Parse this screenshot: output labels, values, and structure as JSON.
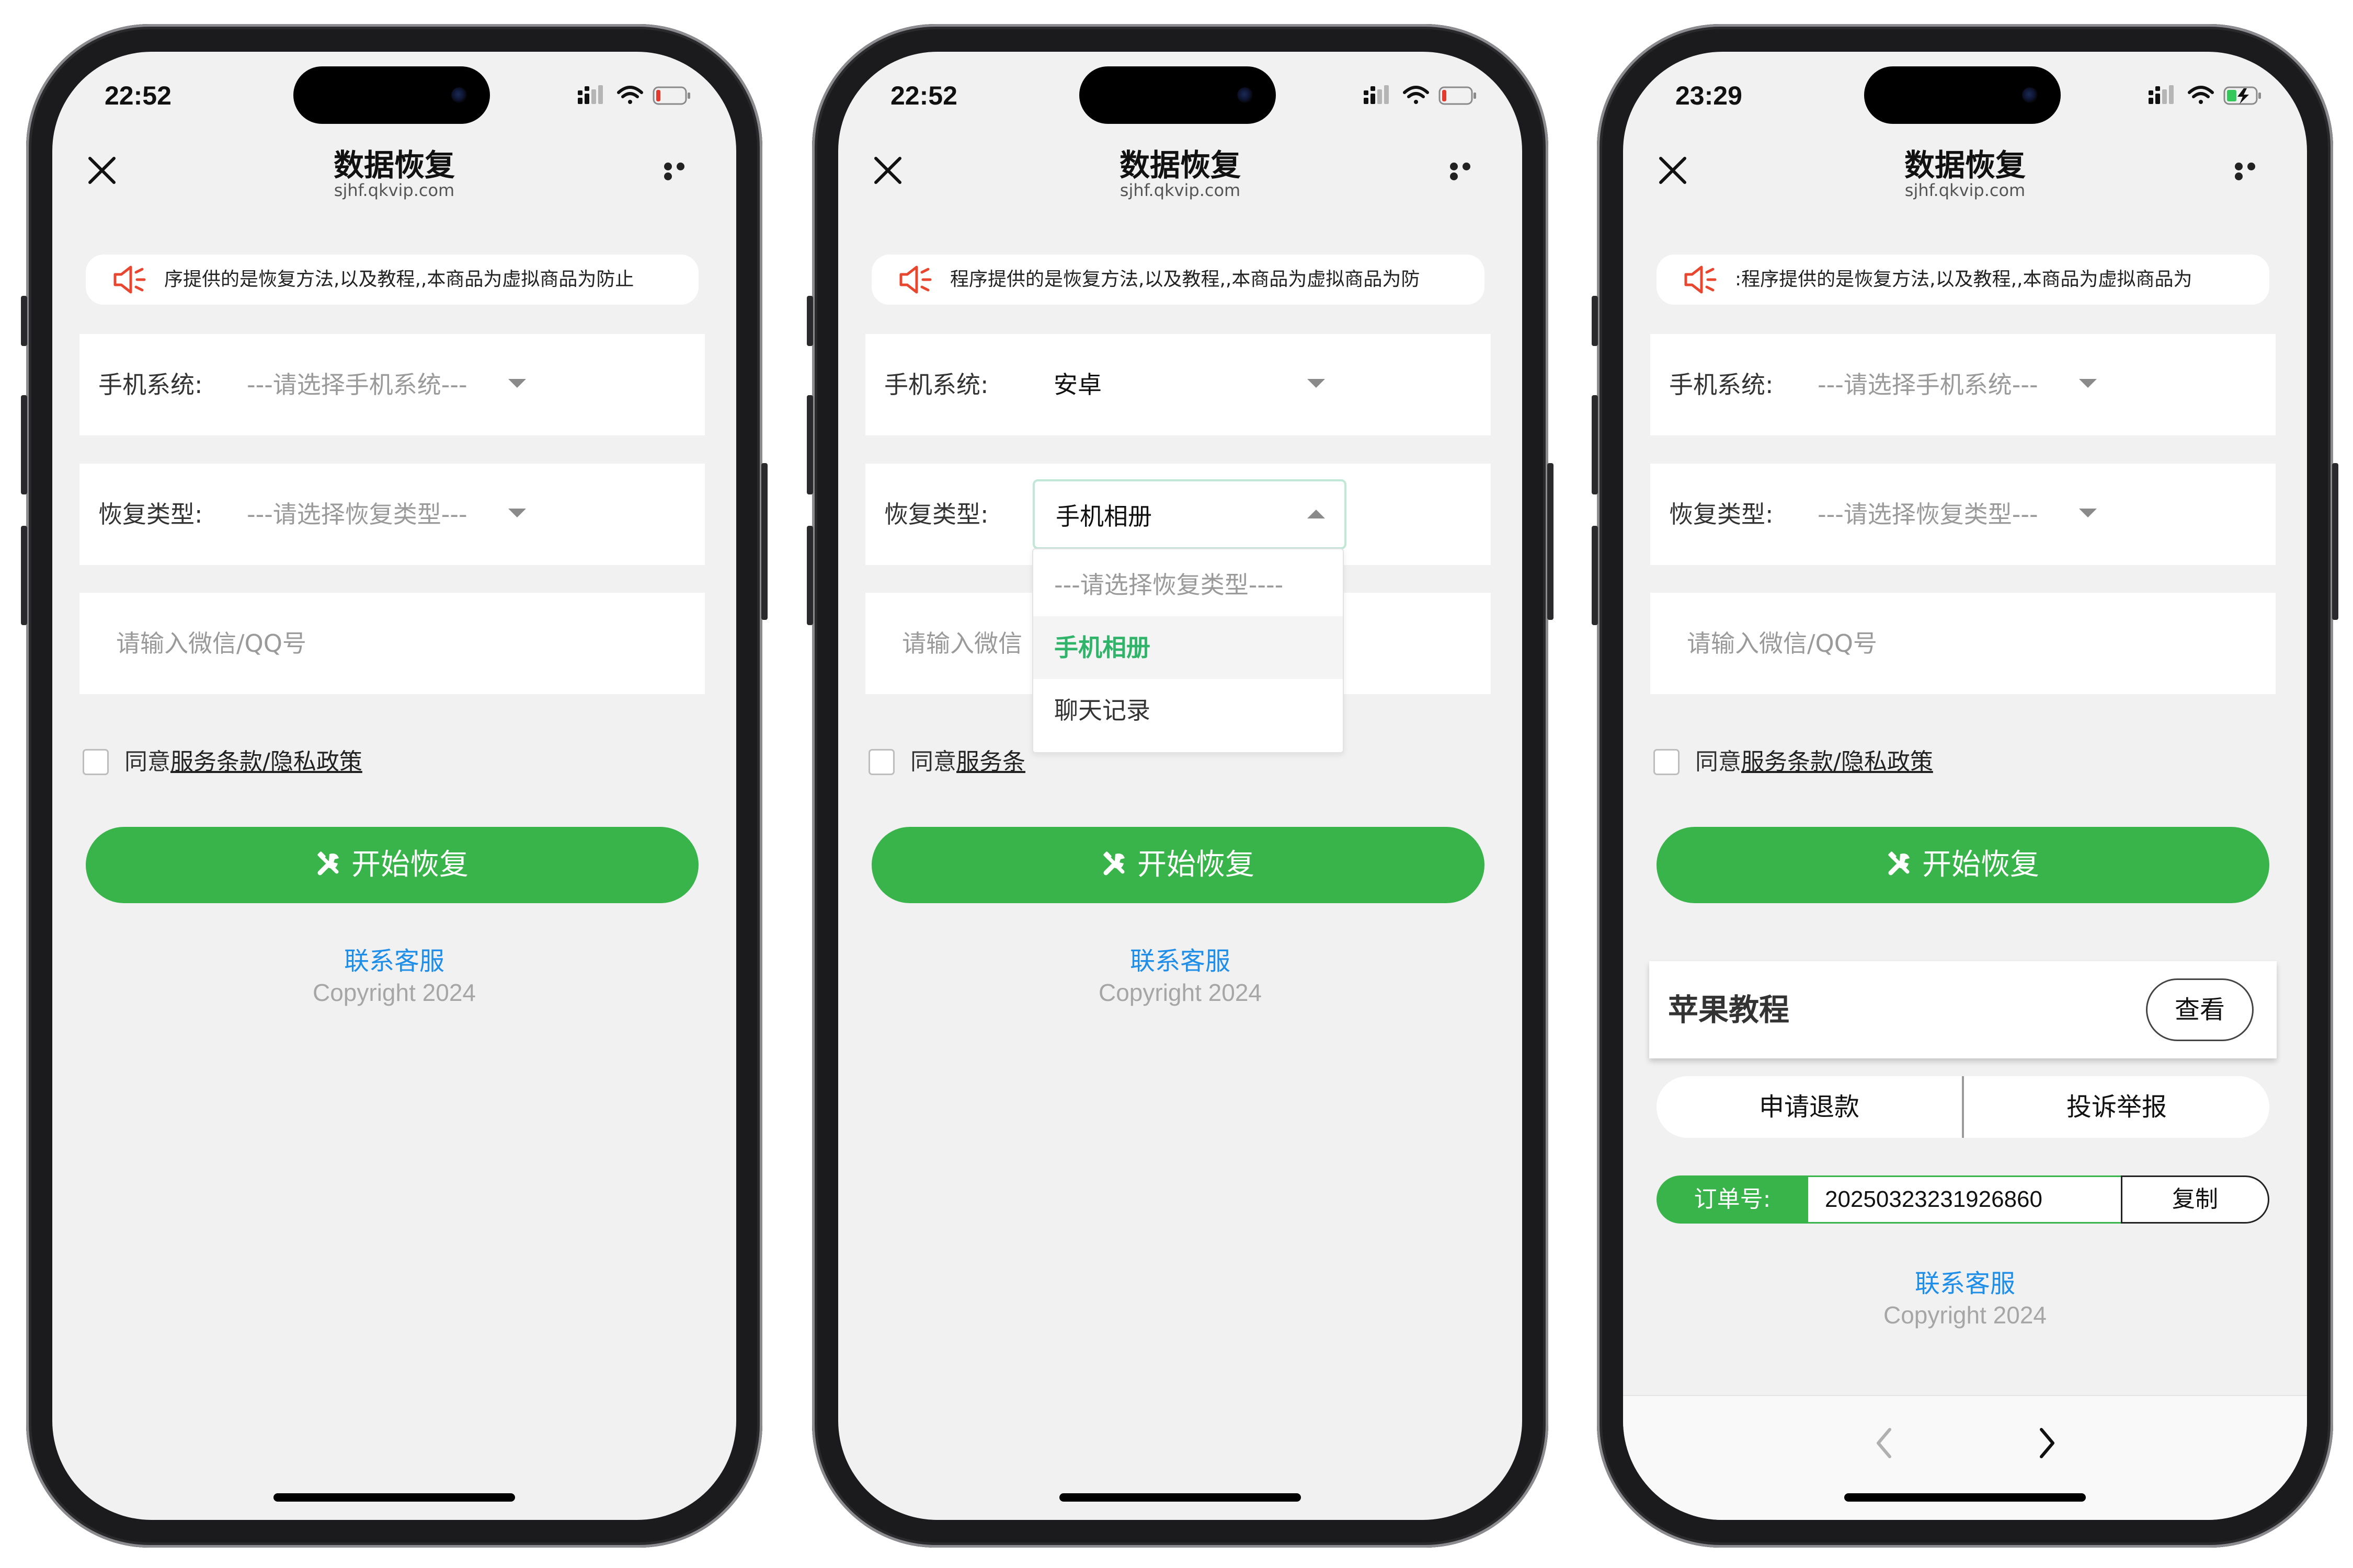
{
  "phones": [
    {
      "status_time": "22:52",
      "nav": {
        "title": "数据恢复",
        "subtitle": "sjhf.qkvip.com"
      },
      "notice_text": "序提供的是恢复方法,以及教程,,本商品为虚拟商品为防止",
      "system_row": {
        "label": "手机系统:",
        "value": "---请选择手机系统---"
      },
      "type_row": {
        "label": "恢复类型:",
        "value": "---请选择恢复类型---"
      },
      "input_placeholder": "请输入微信/QQ号",
      "agree": {
        "prefix": "同意",
        "link": "服务条款/隐私政策"
      },
      "start_button": "开始恢复",
      "support_link": "联系客服",
      "copyright": "Copyright 2024"
    },
    {
      "status_time": "22:52",
      "nav": {
        "title": "数据恢复",
        "subtitle": "sjhf.qkvip.com"
      },
      "notice_text": "程序提供的是恢复方法,以及教程,,本商品为虚拟商品为防",
      "system_row": {
        "label": "手机系统:",
        "value": "安卓"
      },
      "type_row": {
        "label": "恢复类型:",
        "value": "手机相册"
      },
      "input_placeholder": "请输入微信",
      "agree": {
        "prefix": "同意",
        "link": "服务条"
      },
      "dropdown": {
        "options": [
          "---请选择恢复类型----",
          "手机相册",
          "聊天记录"
        ],
        "selected": "手机相册"
      },
      "start_button": "开始恢复",
      "support_link": "联系客服",
      "copyright": "Copyright 2024"
    },
    {
      "status_time": "23:29",
      "nav": {
        "title": "数据恢复",
        "subtitle": "sjhf.qkvip.com"
      },
      "notice_text": ":程序提供的是恢复方法,以及教程,,本商品为虚拟商品为",
      "system_row": {
        "label": "手机系统:",
        "value": "---请选择手机系统---"
      },
      "type_row": {
        "label": "恢复类型:",
        "value": "---请选择恢复类型---"
      },
      "input_placeholder": "请输入微信/QQ号",
      "agree": {
        "prefix": "同意",
        "link": "服务条款/隐私政策"
      },
      "start_button": "开始恢复",
      "tutorial": {
        "title": "苹果教程",
        "button": "查看"
      },
      "actions": {
        "refund": "申请退款",
        "report": "投诉举报"
      },
      "order": {
        "label": "订单号:",
        "value": "20250323231926860",
        "copy": "复制"
      },
      "support_link": "联系客服",
      "copyright": "Copyright 2024"
    }
  ],
  "colors": {
    "accent_green": "#39b44a",
    "link_blue": "#1e8ee8",
    "notice_red": "#e8462f",
    "dropdown_selected": "#2fb46a",
    "page_bg": "#f1f1f1"
  },
  "icons": {
    "close": "close-icon",
    "more": "more-icon",
    "speaker": "speaker-icon",
    "tool": "tools-icon",
    "signal": "cellular-signal-icon",
    "wifi": "wifi-icon",
    "battery": "battery-icon",
    "back": "chevron-left-icon",
    "forward": "chevron-right-icon"
  }
}
